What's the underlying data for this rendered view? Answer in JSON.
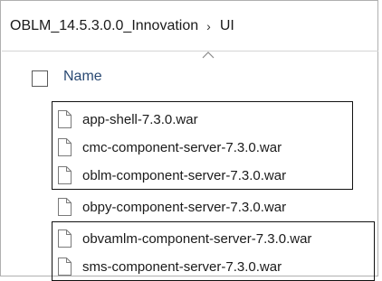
{
  "breadcrumb": {
    "folder": "OBLM_14.5.3.0.0_Innovation",
    "separator": "›",
    "current": "UI"
  },
  "header": {
    "name_label": "Name"
  },
  "files": [
    {
      "name": "app-shell-7.3.0.war",
      "icon": "file-icon"
    },
    {
      "name": "cmc-component-server-7.3.0.war",
      "icon": "file-icon"
    },
    {
      "name": "oblm-component-server-7.3.0.war",
      "icon": "file-icon"
    },
    {
      "name": "obpy-component-server-7.3.0.war",
      "icon": "file-icon"
    },
    {
      "name": "obvamlm-component-server-7.3.0.war",
      "icon": "file-icon"
    },
    {
      "name": "sms-component-server-7.3.0.war",
      "icon": "file-icon"
    }
  ],
  "colors": {
    "header_text": "#2b4a73",
    "highlight_border": "#111111"
  }
}
